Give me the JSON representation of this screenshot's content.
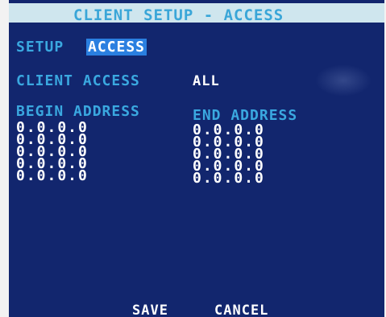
{
  "title": "CLIENT SETUP - ACCESS",
  "setup": {
    "label": "SETUP",
    "value": "ACCESS"
  },
  "client_access": {
    "label": "CLIENT ACCESS",
    "value": "ALL"
  },
  "columns": {
    "begin": "BEGIN ADDRESS",
    "end": "END ADDRESS"
  },
  "rows": [
    {
      "begin": "0.0.0.0",
      "end": "0.0.0.0"
    },
    {
      "begin": "0.0.0.0",
      "end": "0.0.0.0"
    },
    {
      "begin": "0.0.0.0",
      "end": "0.0.0.0"
    },
    {
      "begin": "0.0.0.0",
      "end": "0.0.0.0"
    },
    {
      "begin": "0.0.0.0",
      "end": "0.0.0.0"
    }
  ],
  "buttons": {
    "save": "SAVE",
    "cancel": "CANCEL"
  },
  "colors": {
    "background": "#12266e",
    "label": "#3aa8e0",
    "title_bar": "#cfe6ee",
    "highlight": "#2a7fe0",
    "value": "#ffffff"
  }
}
